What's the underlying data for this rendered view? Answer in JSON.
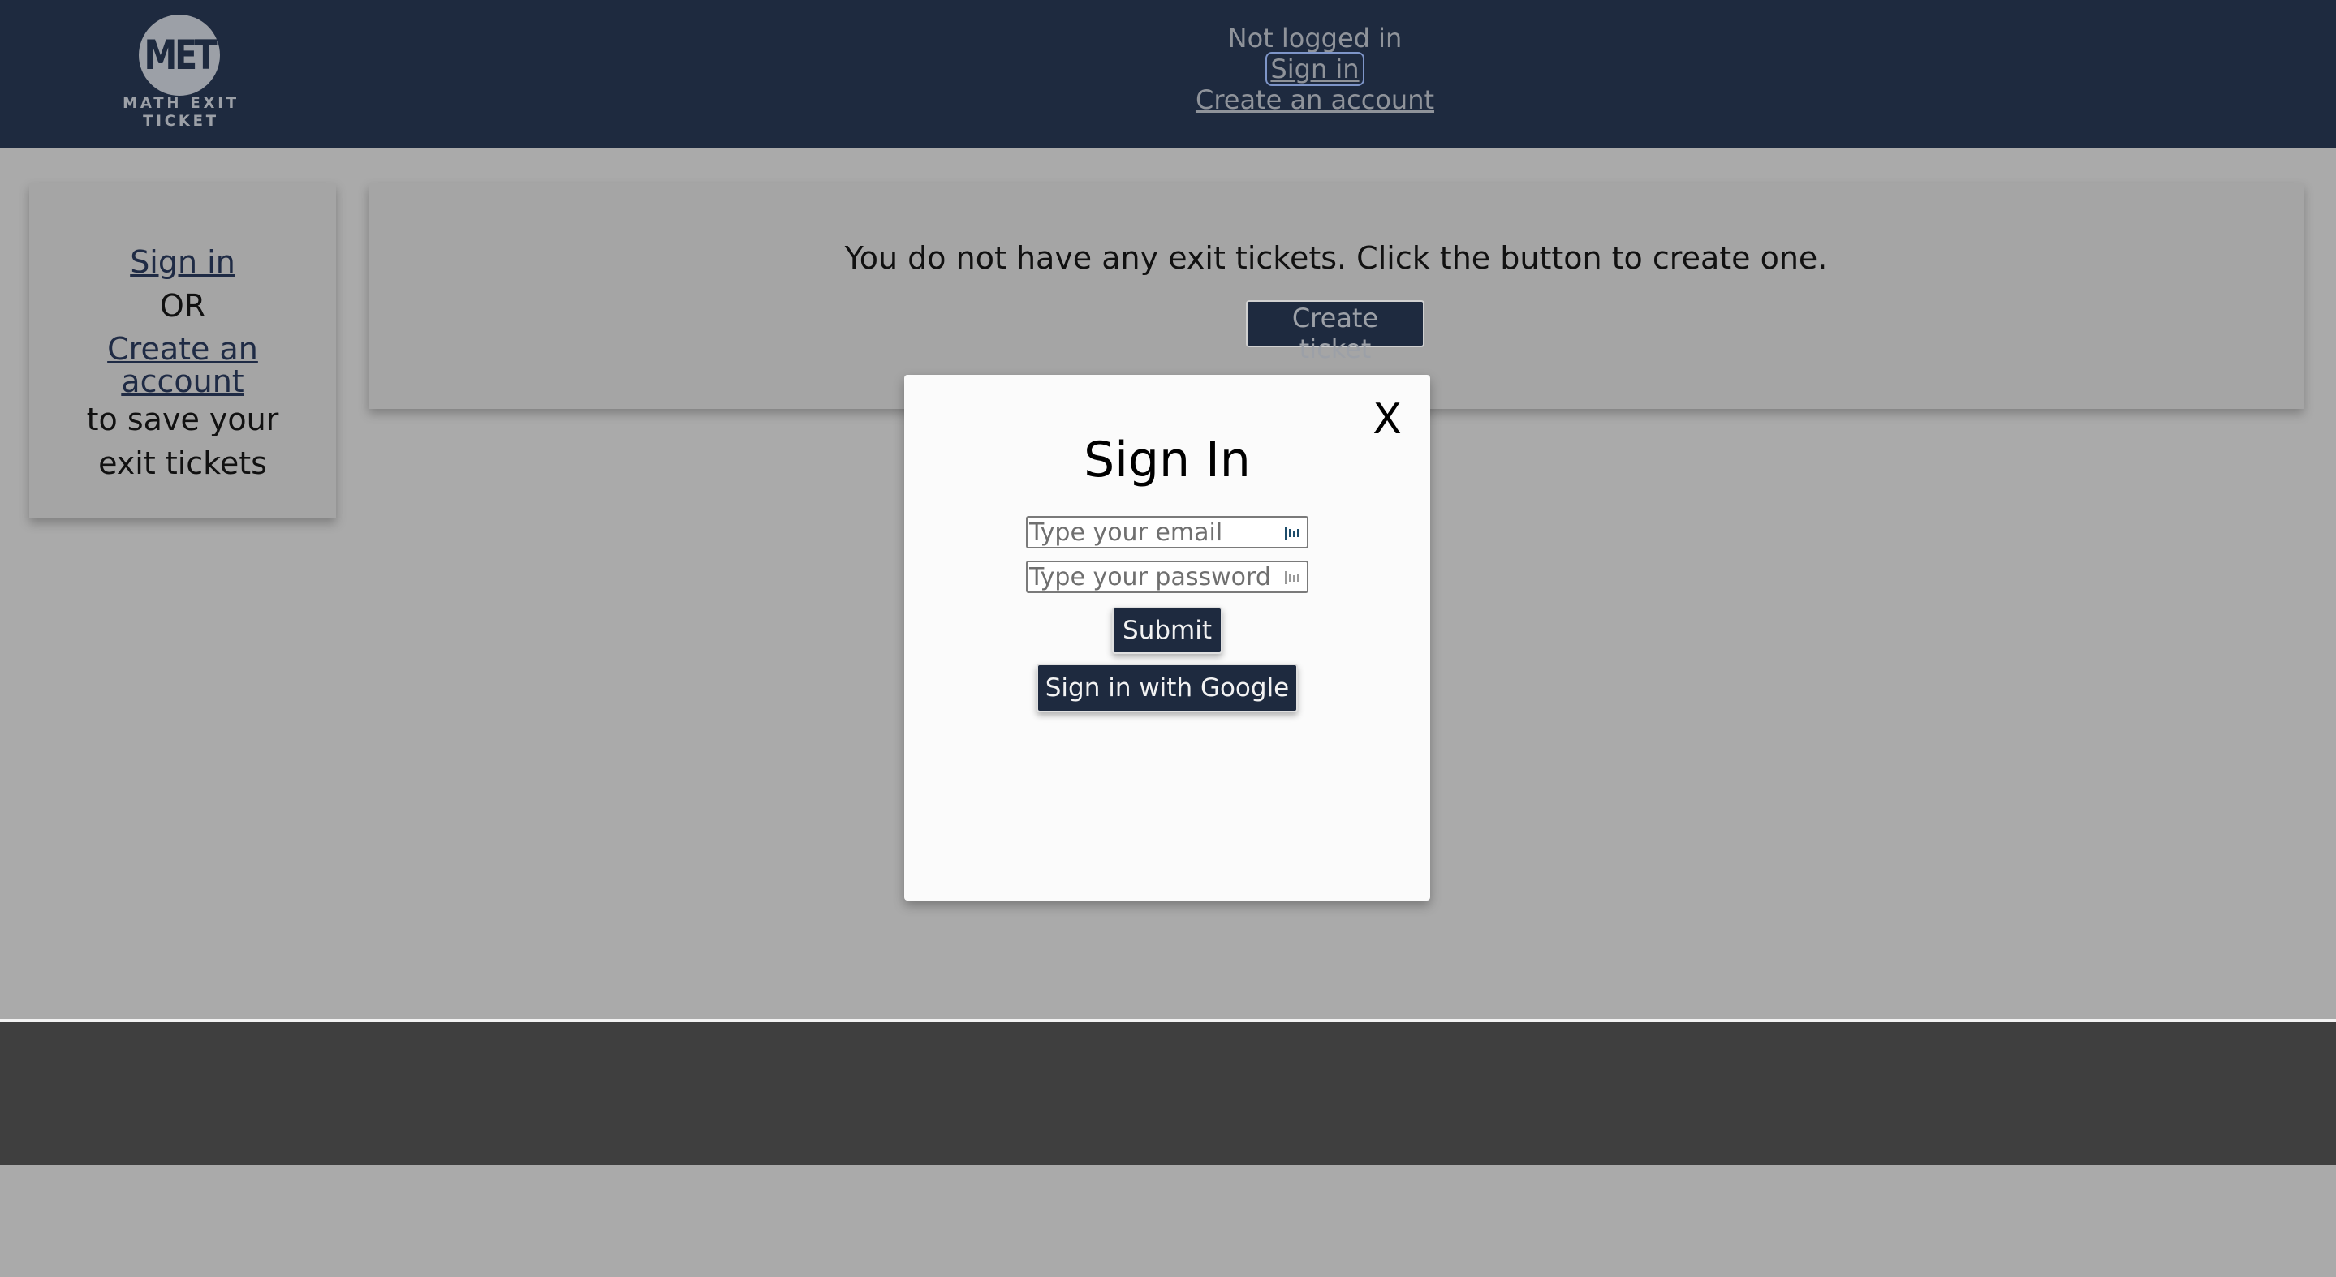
{
  "header": {
    "logo": {
      "mark": "MET",
      "caption": "MATH EXIT TICKET"
    },
    "status_text": "Not logged in",
    "sign_in_label": "Sign in",
    "create_account_label": "Create an account"
  },
  "sidebar": {
    "sign_in_label": "Sign in",
    "or_text": "OR",
    "create_account_label": "Create an account",
    "save_text": "to save your exit tickets"
  },
  "main": {
    "message": "You do not have any exit tickets. Click the button to create one.",
    "create_ticket_label": "Create ticket"
  },
  "modal": {
    "close_label": "X",
    "title": "Sign In",
    "email_placeholder": "Type your email",
    "password_placeholder": "Type your password",
    "submit_label": "Submit",
    "google_label": "Sign in with Google"
  },
  "colors": {
    "header_bg": "#1e2a3f",
    "page_bg": "#aaaaaa",
    "footer_bg": "#3f3f3f",
    "modal_bg": "#fbfbfb"
  }
}
